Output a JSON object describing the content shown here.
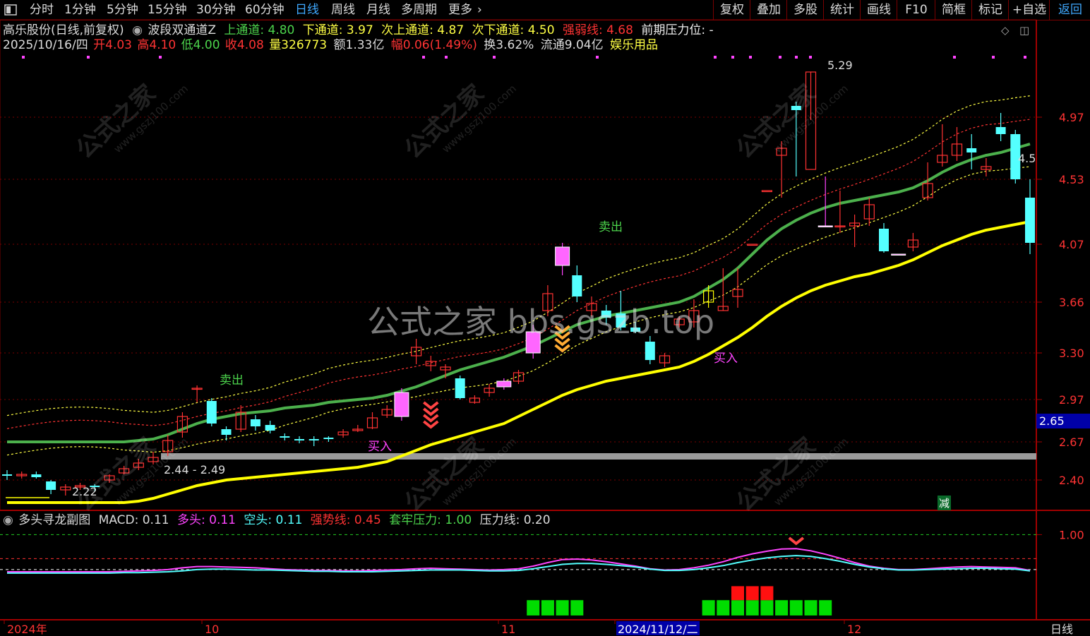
{
  "toolbar": {
    "left_items": [
      "分时",
      "1分钟",
      "5分钟",
      "15分钟",
      "30分钟",
      "60分钟",
      "日线",
      "周线",
      "月线",
      "多周期",
      "更多"
    ],
    "active": "日线",
    "right_items": [
      "复权",
      "叠加",
      "多股",
      "统计",
      "画线",
      "F10",
      "简框",
      "标记",
      "+自选",
      "返回"
    ],
    "right_active": "返回"
  },
  "header": {
    "stock": "高乐股份(日线,前复权)",
    "indicator_name": "波段双通道Z",
    "upper_label": "上通道: 4.80",
    "lower_label": "下通道: 3.97",
    "sub_upper_label": "次上通道: 4.87",
    "sub_lower_label": "次下通道: 4.50",
    "strength_label": "强弱线: 4.68",
    "pressure_label": "前期压力位: -"
  },
  "quote": {
    "date": "2025/10/16/四",
    "open": "开4.03",
    "high": "高4.10",
    "low": "低4.00",
    "close": "收4.08",
    "volume": "量326773",
    "amount": "额1.33亿",
    "change": "幅0.06(1.49%)",
    "turnover": "换3.62%",
    "float": "流通9.04亿",
    "sector": "娱乐用品"
  },
  "price_axis": [
    "4.97",
    "4.53",
    "4.07",
    "3.66",
    "3.30",
    "2.97",
    "2.67",
    "2.40"
  ],
  "price_cursor": "2.65",
  "annotations": {
    "sell1": "卖出",
    "sell2": "卖出",
    "buy1": "买入",
    "buy2": "买入",
    "high_price": "5.29",
    "low_price": "2.22",
    "range_label": "2.44 - 2.49",
    "right_value": "4.5",
    "reduce": "减",
    "watermark_center": "公式之家 bbs.gszb.top",
    "watermark_small": "公式之家",
    "watermark_url": "www.gszj100.com"
  },
  "sub_header": {
    "name": "多头寻龙副图",
    "macd": "MACD: 0.11",
    "long": "多头: 0.11",
    "short": "空头: 0.11",
    "strong": "强势线: 0.45",
    "trap": "套牢压力: 1.00",
    "pressure": "压力线: 0.20"
  },
  "sub_axis": [
    "1.00"
  ],
  "bottom_axis": {
    "labels": [
      "2024年",
      "10",
      "11",
      "2024/11/12/二",
      "12"
    ],
    "period": "日线"
  },
  "colors": {
    "up": "#ff3232",
    "down": "#54ffff",
    "ma_green": "#4cb04c",
    "ma_yellow": "#ffff00",
    "magenta": "#ff44ff",
    "channel_yellow": "#ffff44",
    "channel_red": "#ff3333",
    "grid": "#7a0000"
  },
  "chart_data": {
    "type": "candlestick",
    "ylim": [
      2.2,
      5.45
    ],
    "candles": [
      [
        2.44,
        2.43,
        2.47,
        2.4
      ],
      [
        2.43,
        2.44,
        2.46,
        2.41
      ],
      [
        2.44,
        2.42,
        2.46,
        2.41
      ],
      [
        2.39,
        2.33,
        2.4,
        2.3
      ],
      [
        2.33,
        2.35,
        2.37,
        2.29
      ],
      [
        2.35,
        2.36,
        2.38,
        2.33
      ],
      [
        2.36,
        2.35,
        2.37,
        2.32
      ],
      [
        2.4,
        2.43,
        2.44,
        2.38
      ],
      [
        2.45,
        2.48,
        2.5,
        2.44
      ],
      [
        2.49,
        2.52,
        2.55,
        2.47
      ],
      [
        2.53,
        2.56,
        2.6,
        2.51
      ],
      [
        2.6,
        2.68,
        2.72,
        2.57
      ],
      [
        2.74,
        2.85,
        2.88,
        2.7
      ],
      [
        3.05,
        3.05,
        3.07,
        2.95
      ],
      [
        2.96,
        2.8,
        2.98,
        2.78
      ],
      [
        2.76,
        2.72,
        2.78,
        2.68
      ],
      [
        2.76,
        2.88,
        2.93,
        2.74
      ],
      [
        2.83,
        2.78,
        2.86,
        2.75
      ],
      [
        2.79,
        2.75,
        2.82,
        2.73
      ],
      [
        2.71,
        2.7,
        2.73,
        2.68
      ],
      [
        2.69,
        2.68,
        2.71,
        2.66
      ],
      [
        2.69,
        2.68,
        2.71,
        2.64
      ],
      [
        2.7,
        2.69,
        2.71,
        2.67
      ],
      [
        2.72,
        2.74,
        2.76,
        2.7
      ],
      [
        2.75,
        2.76,
        2.79,
        2.74
      ],
      [
        2.77,
        2.84,
        2.88,
        2.76
      ],
      [
        2.86,
        2.9,
        2.93,
        2.84
      ],
      [
        3.02,
        2.85,
        3.05,
        2.82
      ],
      [
        3.28,
        3.34,
        3.4,
        3.22
      ],
      [
        3.21,
        3.24,
        3.28,
        3.17
      ],
      [
        3.18,
        3.2,
        3.22,
        3.12
      ],
      [
        3.12,
        2.98,
        3.14,
        2.97
      ],
      [
        2.95,
        2.98,
        3.0,
        2.94
      ],
      [
        3.02,
        3.05,
        3.08,
        2.99
      ],
      [
        3.06,
        3.1,
        3.12,
        3.04
      ],
      [
        3.1,
        3.16,
        3.18,
        3.08
      ],
      [
        3.3,
        3.45,
        3.5,
        3.26
      ],
      [
        3.6,
        3.72,
        3.78,
        3.56
      ],
      [
        3.92,
        4.05,
        4.08,
        3.85
      ],
      [
        3.85,
        3.7,
        3.92,
        3.66
      ],
      [
        3.6,
        3.65,
        3.7,
        3.56
      ],
      [
        3.6,
        3.55,
        3.64,
        3.5
      ],
      [
        3.58,
        3.48,
        3.74,
        3.46
      ],
      [
        3.48,
        3.45,
        3.52,
        3.44
      ],
      [
        3.38,
        3.25,
        3.42,
        3.22
      ],
      [
        3.23,
        3.28,
        3.3,
        3.2
      ],
      [
        3.5,
        3.54,
        3.56,
        3.48
      ],
      [
        3.52,
        3.6,
        3.68,
        3.48
      ],
      [
        3.66,
        3.74,
        3.78,
        3.62
      ],
      [
        3.6,
        3.63,
        3.9,
        3.6
      ],
      [
        3.7,
        3.75,
        3.9,
        3.62
      ],
      [
        4.07,
        4.07,
        4.07,
        4.07
      ],
      [
        4.45,
        4.45,
        4.45,
        4.45
      ],
      [
        4.7,
        4.75,
        4.8,
        4.4
      ],
      [
        5.05,
        5.02,
        5.08,
        4.55
      ],
      [
        4.6,
        5.29,
        5.29,
        4.95
      ],
      [
        4.2,
        4.2,
        4.55,
        4.2
      ],
      [
        4.2,
        4.2,
        4.45,
        4.15
      ],
      [
        4.2,
        4.22,
        4.28,
        4.05
      ],
      [
        4.25,
        4.35,
        4.4,
        4.2
      ],
      [
        4.18,
        4.02,
        4.22,
        4.01
      ],
      [
        4.0,
        4.0,
        4.0,
        4.0
      ],
      [
        4.05,
        4.1,
        4.15,
        4.02
      ],
      [
        4.4,
        4.5,
        4.65,
        4.38
      ],
      [
        4.65,
        4.7,
        4.92,
        4.62
      ],
      [
        4.7,
        4.78,
        4.9,
        4.66
      ],
      [
        4.75,
        4.72,
        4.85,
        4.6
      ],
      [
        4.6,
        4.62,
        4.68,
        4.55
      ],
      [
        4.9,
        4.85,
        5.0,
        4.8
      ],
      [
        4.85,
        4.53,
        4.88,
        4.5
      ],
      [
        4.4,
        4.08,
        4.53,
        4.0
      ]
    ],
    "ma_green": [
      2.67,
      2.67,
      2.67,
      2.67,
      2.67,
      2.67,
      2.67,
      2.67,
      2.67,
      2.68,
      2.69,
      2.72,
      2.76,
      2.8,
      2.83,
      2.85,
      2.87,
      2.88,
      2.89,
      2.91,
      2.92,
      2.93,
      2.95,
      2.96,
      2.97,
      2.98,
      3.0,
      3.03,
      3.06,
      3.1,
      3.14,
      3.18,
      3.21,
      3.24,
      3.27,
      3.31,
      3.35,
      3.4,
      3.45,
      3.5,
      3.53,
      3.56,
      3.58,
      3.6,
      3.62,
      3.64,
      3.66,
      3.7,
      3.76,
      3.82,
      3.9,
      4.0,
      4.1,
      4.18,
      4.24,
      4.29,
      4.33,
      4.36,
      4.38,
      4.4,
      4.42,
      4.44,
      4.47,
      4.52,
      4.58,
      4.63,
      4.67,
      4.7,
      4.72,
      4.75,
      4.78
    ],
    "ma_yellow": [
      2.24,
      2.24,
      2.24,
      2.24,
      2.24,
      2.24,
      2.24,
      2.24,
      2.24,
      2.25,
      2.27,
      2.3,
      2.33,
      2.36,
      2.38,
      2.4,
      2.41,
      2.42,
      2.43,
      2.44,
      2.45,
      2.46,
      2.47,
      2.48,
      2.49,
      2.51,
      2.53,
      2.57,
      2.61,
      2.65,
      2.68,
      2.71,
      2.74,
      2.77,
      2.8,
      2.85,
      2.9,
      2.95,
      3.0,
      3.04,
      3.07,
      3.1,
      3.12,
      3.14,
      3.16,
      3.18,
      3.2,
      3.24,
      3.29,
      3.35,
      3.41,
      3.48,
      3.56,
      3.63,
      3.69,
      3.74,
      3.78,
      3.81,
      3.84,
      3.86,
      3.89,
      3.92,
      3.96,
      4.01,
      4.06,
      4.1,
      4.14,
      4.17,
      4.19,
      4.21,
      4.23
    ],
    "macd_long": [
      0.15,
      0.15,
      0.15,
      0.15,
      0.15,
      0.15,
      0.15,
      0.15,
      0.16,
      0.17,
      0.18,
      0.2,
      0.24,
      0.27,
      0.27,
      0.26,
      0.25,
      0.24,
      0.22,
      0.2,
      0.19,
      0.18,
      0.18,
      0.17,
      0.17,
      0.18,
      0.19,
      0.2,
      0.22,
      0.23,
      0.22,
      0.21,
      0.2,
      0.19,
      0.2,
      0.22,
      0.28,
      0.36,
      0.43,
      0.44,
      0.42,
      0.38,
      0.33,
      0.28,
      0.22,
      0.19,
      0.2,
      0.24,
      0.3,
      0.38,
      0.48,
      0.56,
      0.62,
      0.67,
      0.68,
      0.63,
      0.55,
      0.46,
      0.36,
      0.28,
      0.23,
      0.2,
      0.2,
      0.22,
      0.24,
      0.26,
      0.27,
      0.26,
      0.25,
      0.24,
      0.18
    ],
    "macd_short": [
      0.12,
      0.12,
      0.12,
      0.12,
      0.12,
      0.12,
      0.12,
      0.12,
      0.13,
      0.13,
      0.14,
      0.15,
      0.17,
      0.2,
      0.21,
      0.21,
      0.2,
      0.19,
      0.19,
      0.18,
      0.17,
      0.16,
      0.16,
      0.15,
      0.15,
      0.15,
      0.16,
      0.17,
      0.18,
      0.19,
      0.19,
      0.19,
      0.18,
      0.17,
      0.17,
      0.18,
      0.22,
      0.27,
      0.32,
      0.34,
      0.34,
      0.32,
      0.29,
      0.26,
      0.21,
      0.18,
      0.18,
      0.2,
      0.24,
      0.29,
      0.36,
      0.42,
      0.47,
      0.5,
      0.52,
      0.5,
      0.45,
      0.39,
      0.32,
      0.26,
      0.22,
      0.19,
      0.19,
      0.2,
      0.21,
      0.22,
      0.23,
      0.23,
      0.22,
      0.21,
      0.17
    ],
    "sub_ylim": [
      -0.9,
      1.2
    ],
    "sub_refs": {
      "trap": 1.0,
      "strong": 0.45,
      "pressure": 0.2
    },
    "green_bars": [
      36,
      37,
      38,
      39,
      48,
      49,
      50,
      51,
      52,
      53,
      54,
      55,
      56
    ],
    "red_bars": [
      50,
      51,
      52
    ]
  }
}
